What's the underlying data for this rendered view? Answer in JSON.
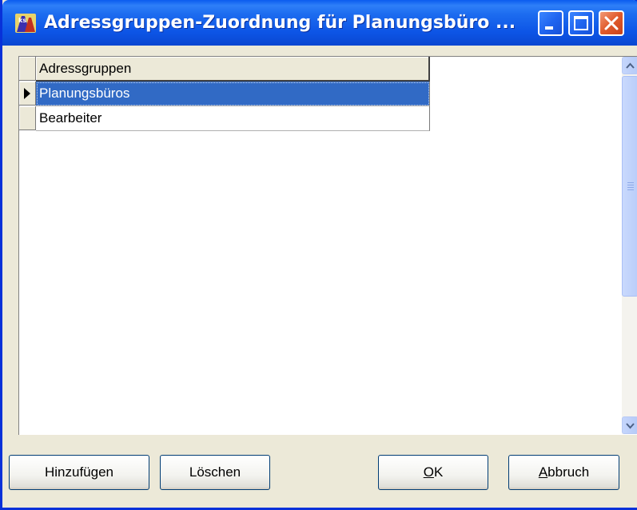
{
  "window": {
    "title": "Adressgruppen-Zuordnung für Planungsbüro ...",
    "icon": "app-logo-icon"
  },
  "grid": {
    "header": "Adressgruppen",
    "rows": [
      {
        "label": "Planungsbüros",
        "selected": true
      },
      {
        "label": "Bearbeiter",
        "selected": false
      }
    ]
  },
  "buttons": {
    "add": "Hinzufügen",
    "delete": "Löschen",
    "ok": {
      "accel": "O",
      "rest": "K"
    },
    "cancel": {
      "accel": "A",
      "rest": "bbruch"
    }
  },
  "colors": {
    "titlebar": "#0a5bef",
    "selection": "#316ac5",
    "dialog_bg": "#ece9d8",
    "close_button": "#e05a2b"
  }
}
